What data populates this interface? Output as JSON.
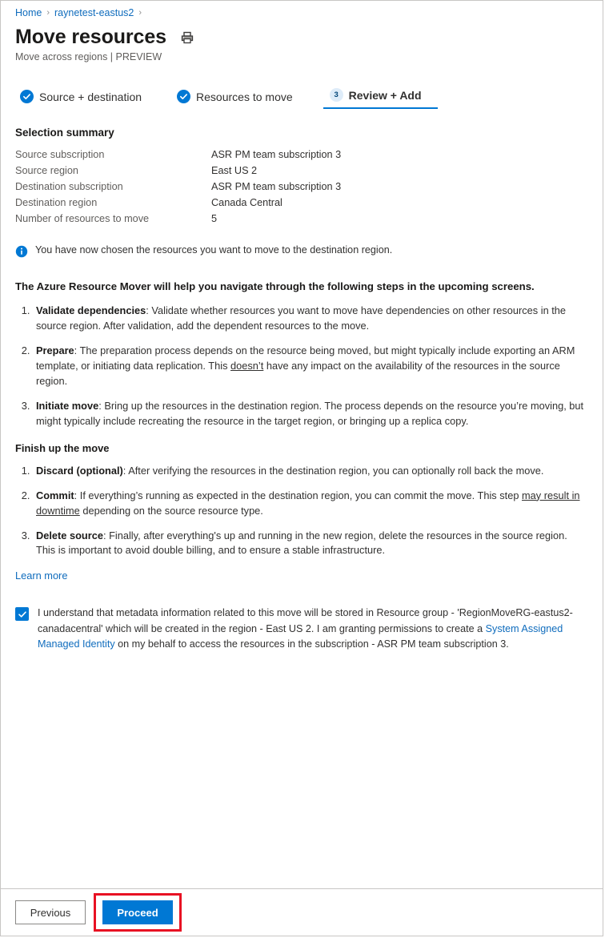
{
  "breadcrumb": {
    "items": [
      {
        "label": "Home"
      },
      {
        "label": "raynetest-eastus2"
      }
    ],
    "separator": "›"
  },
  "header": {
    "title": "Move resources",
    "subtitle": "Move across regions | PREVIEW",
    "print_icon": "printer-icon"
  },
  "tabs": [
    {
      "label": "Source + destination",
      "state": "complete",
      "marker": "check"
    },
    {
      "label": "Resources to move",
      "state": "complete",
      "marker": "check"
    },
    {
      "label": "Review + Add",
      "state": "active",
      "marker": "3"
    }
  ],
  "selection_summary": {
    "heading": "Selection summary",
    "rows": [
      {
        "label": "Source subscription",
        "value": "ASR PM team subscription 3"
      },
      {
        "label": "Source region",
        "value": "East US 2"
      },
      {
        "label": "Destination subscription",
        "value": "ASR PM team subscription 3"
      },
      {
        "label": "Destination region",
        "value": "Canada Central"
      },
      {
        "label": "Number of resources to move",
        "value": "5"
      }
    ]
  },
  "info_message": {
    "icon": "info-icon",
    "text": "You have now chosen the resources you want to move to the destination region."
  },
  "lead_paragraph": "The Azure Resource Mover will help you navigate through the following steps in the upcoming screens.",
  "upcoming_steps": [
    {
      "term": "Validate dependencies",
      "sep": ": ",
      "body_before": "Validate whether resources you want to move have dependencies on other resources in the source region. After validation, add the dependent resources to the move.",
      "underlined": "",
      "body_after": ""
    },
    {
      "term": "Prepare",
      "sep": ": ",
      "body_before": "The preparation process depends on the resource being moved, but might typically include exporting an ARM template, or initiating data replication. This ",
      "underlined": "doesn’t",
      "body_after": " have any impact on the availability of the resources in the source region."
    },
    {
      "term": "Initiate move",
      "sep": ": ",
      "body_before": "Bring up the resources in the destination region. The process depends on the resource you’re moving, but might typically include recreating the resource in the target region, or bringing up a replica copy.",
      "underlined": "",
      "body_after": ""
    }
  ],
  "finish_section": {
    "heading": "Finish up the move",
    "steps": [
      {
        "term": "Discard (optional)",
        "sep": ": ",
        "body_before": "After verifying the resources in the destination region, you can optionally roll back the move.",
        "underlined": "",
        "body_after": ""
      },
      {
        "term": "Commit",
        "sep": ": ",
        "body_before": "If everything’s running as expected in the destination region, you can commit the move. This step ",
        "underlined": "may result in downtime",
        "body_after": " depending on the source resource type."
      },
      {
        "term": "Delete source",
        "sep": ": ",
        "body_before": "Finally, after everything's up and running in the new region, delete the resources in the source region. This is important to avoid double billing, and to ensure a stable infrastructure.",
        "underlined": "",
        "body_after": ""
      }
    ]
  },
  "learn_more_label": "Learn more",
  "consent": {
    "checked": true,
    "text_part1": "I understand that metadata information related to this move will be stored in Resource group - 'RegionMoveRG-eastus2-canadacentral' which will be created in the region - East US 2. I am granting permissions to create a ",
    "link_text": "System Assigned Managed Identity",
    "text_part2": " on my behalf to access the resources in the subscription - ASR PM team subscription 3."
  },
  "footer": {
    "previous_label": "Previous",
    "proceed_label": "Proceed",
    "highlight_color": "#e81123"
  },
  "colors": {
    "accent": "#0078d4",
    "link": "#0f6cbd",
    "highlight": "#e81123",
    "step_badge_bg": "#deecf9"
  }
}
